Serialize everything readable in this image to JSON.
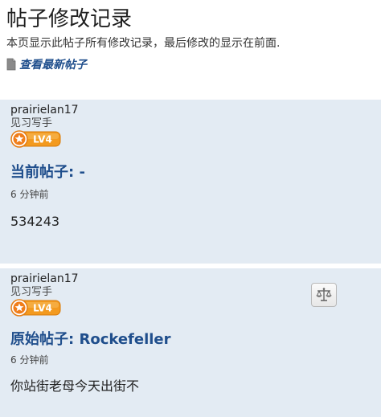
{
  "page": {
    "title": "帖子修改记录",
    "description": "本页显示此帖子所有修改记录，最后修改的显示在前面.",
    "latest_link": "查看最新帖子"
  },
  "current_post": {
    "username": "prairielan17",
    "rank": "见习写手",
    "level": "LV4",
    "heading": "当前帖子: -",
    "time": "6 分钟前",
    "body": "534243"
  },
  "original_post": {
    "username": "prairielan17",
    "rank": "见习写手",
    "level": "LV4",
    "heading": "原始帖子: Rockefeller",
    "time": "6 分钟前",
    "body": "你站街老母今天出街不"
  },
  "icons": {
    "document": "document-icon",
    "level_badge": "star-badge-icon",
    "compare": "scales-icon"
  },
  "colors": {
    "link": "#1f4e8c",
    "card_background": "#e3ebf3",
    "badge_orange": "#f39a1f"
  }
}
